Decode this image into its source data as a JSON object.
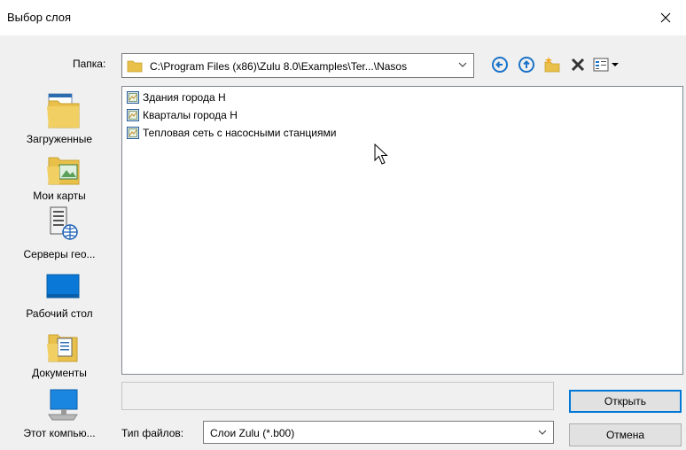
{
  "dialog": {
    "title": "Выбор слоя",
    "folder_label": "Папка:",
    "folder_path": "C:\\Program Files (x86)\\Zulu 8.0\\Examples\\Ter...\\Nasos"
  },
  "toolbar": {
    "icons": [
      "back-icon",
      "up-folder-icon",
      "new-folder-icon",
      "delete-icon",
      "view-menu-icon"
    ]
  },
  "places": [
    {
      "label": "Загруженные",
      "icon": "downloads-folder-icon"
    },
    {
      "label": "Мои карты",
      "icon": "my-maps-folder-icon"
    },
    {
      "label": "Серверы гео...",
      "icon": "geo-servers-icon"
    },
    {
      "label": "Рабочий стол",
      "icon": "desktop-icon"
    },
    {
      "label": "Документы",
      "icon": "documents-icon"
    },
    {
      "label": "Этот компью...",
      "icon": "this-computer-icon"
    }
  ],
  "files": [
    {
      "name": "Здания города Н",
      "icon": "layer-file-icon"
    },
    {
      "name": "Кварталы города Н",
      "icon": "layer-file-icon"
    },
    {
      "name": "Тепловая сеть с насосными станциями",
      "icon": "layer-file-icon"
    }
  ],
  "filename": {
    "value": ""
  },
  "filetype": {
    "label": "Тип файлов:",
    "value": "Слои Zulu (*.b00)"
  },
  "buttons": {
    "open": "Открыть",
    "cancel": "Отмена"
  },
  "colors": {
    "accent": "#0078d7",
    "folder": "#e8c04a",
    "toolbar_blue": "#1a73c8"
  }
}
